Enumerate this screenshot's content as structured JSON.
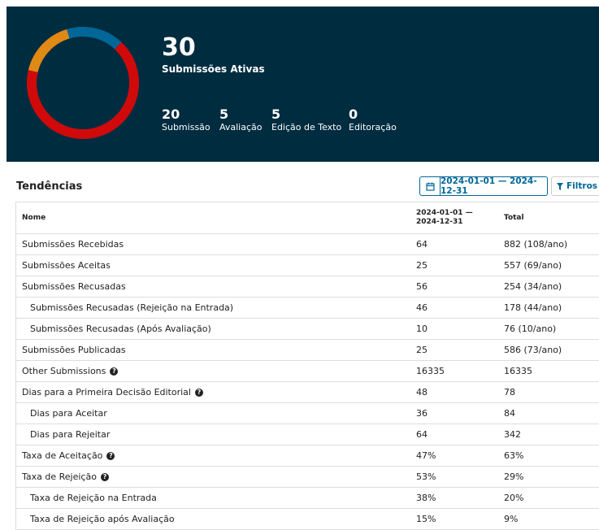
{
  "hero": {
    "total": "30",
    "total_label": "Submissões Ativas",
    "stages": [
      {
        "count": "20",
        "label": "Submissão",
        "color": "#d00a0a"
      },
      {
        "count": "5",
        "label": "Avaliação",
        "color": "#e08914"
      },
      {
        "count": "5",
        "label": "Edição de Texto",
        "color": "#006798"
      },
      {
        "count": "0",
        "label": "Editoração",
        "color": "#00b28d"
      }
    ]
  },
  "trends": {
    "title": "Tendências",
    "date_range": "2024-01-01 — 2024-12-31",
    "calendar_icon": "calendar-icon",
    "filter_label": "Filtros",
    "filter_icon": "filter-icon",
    "columns": [
      "Nome",
      "2024-01-01 — 2024-12-31",
      "Total"
    ],
    "rows": [
      {
        "name": "Submissões Recebidas",
        "period": "64",
        "total": "882 (108/ano)",
        "indent": false,
        "help": false
      },
      {
        "name": "Submissões Aceitas",
        "period": "25",
        "total": "557 (69/ano)",
        "indent": false,
        "help": false
      },
      {
        "name": "Submissões Recusadas",
        "period": "56",
        "total": "254 (34/ano)",
        "indent": false,
        "help": false
      },
      {
        "name": "Submissões Recusadas (Rejeição na Entrada)",
        "period": "46",
        "total": "178 (44/ano)",
        "indent": true,
        "help": false
      },
      {
        "name": "Submissões Recusadas (Após Avaliação)",
        "period": "10",
        "total": "76 (10/ano)",
        "indent": true,
        "help": false
      },
      {
        "name": "Submissões Publicadas",
        "period": "25",
        "total": "586 (73/ano)",
        "indent": false,
        "help": false
      },
      {
        "name": "Other Submissions",
        "period": "16335",
        "total": "16335",
        "indent": false,
        "help": true
      },
      {
        "name": "Dias para a Primeira Decisão Editorial",
        "period": "48",
        "total": "78",
        "indent": false,
        "help": true
      },
      {
        "name": "Dias para Aceitar",
        "period": "36",
        "total": "84",
        "indent": true,
        "help": false
      },
      {
        "name": "Dias para Rejeitar",
        "period": "64",
        "total": "342",
        "indent": true,
        "help": false
      },
      {
        "name": "Taxa de Aceitação",
        "period": "47%",
        "total": "63%",
        "indent": false,
        "help": true
      },
      {
        "name": "Taxa de Rejeição",
        "period": "53%",
        "total": "29%",
        "indent": false,
        "help": true
      },
      {
        "name": "Taxa de Rejeição na Entrada",
        "period": "38%",
        "total": "20%",
        "indent": true,
        "help": false
      },
      {
        "name": "Taxa de Rejeição após Avaliação",
        "period": "15%",
        "total": "9%",
        "indent": true,
        "help": false
      }
    ]
  }
}
